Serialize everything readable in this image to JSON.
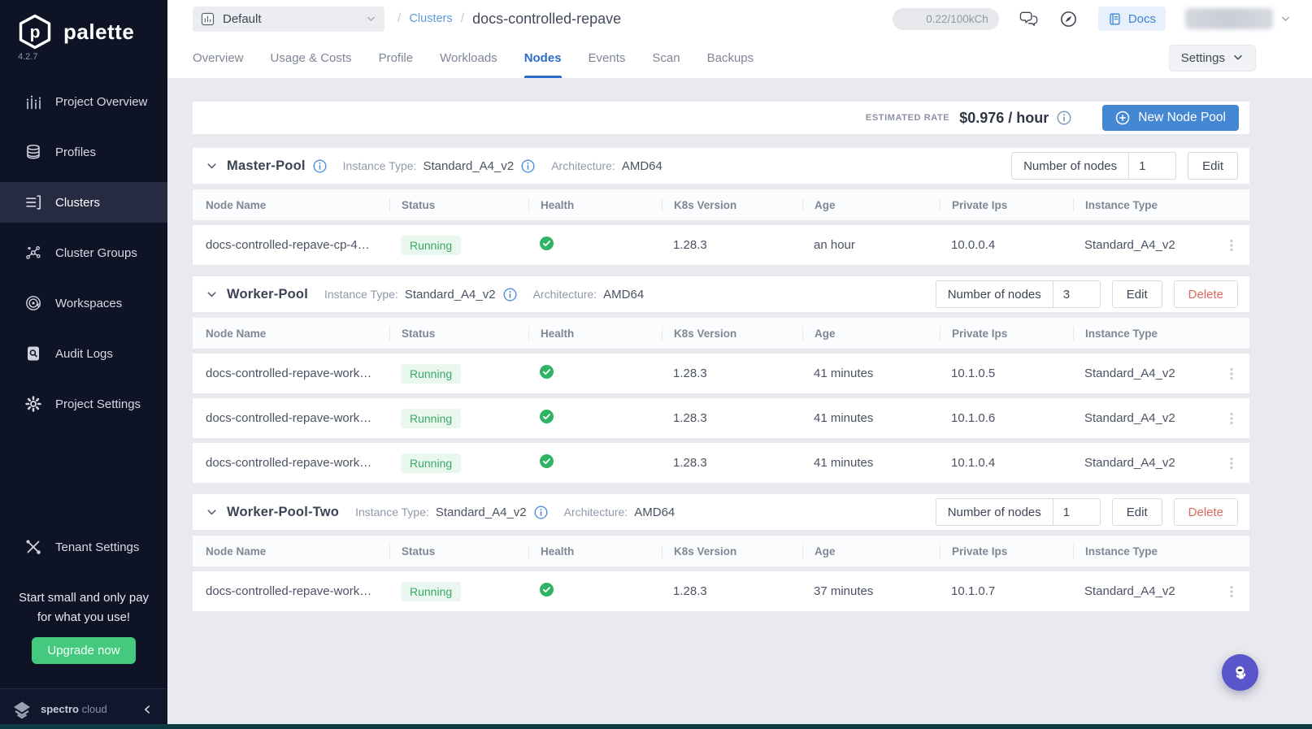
{
  "brand": {
    "name": "palette",
    "version": "4.2.7"
  },
  "sidebar": {
    "items": [
      {
        "label": "Project Overview",
        "icon": "chart",
        "active": false
      },
      {
        "label": "Profiles",
        "icon": "layers",
        "active": false
      },
      {
        "label": "Clusters",
        "icon": "clusters",
        "active": true
      },
      {
        "label": "Cluster Groups",
        "icon": "network",
        "active": false
      },
      {
        "label": "Workspaces",
        "icon": "target",
        "active": false
      },
      {
        "label": "Audit Logs",
        "icon": "audit",
        "active": false
      },
      {
        "label": "Project Settings",
        "icon": "gear",
        "active": false
      },
      {
        "label": "Tenant Settings",
        "icon": "tools",
        "active": false,
        "spacer_before": true
      }
    ],
    "promo": {
      "line1": "Start small and only pay",
      "line2": "for what you use!",
      "upgrade_label": "Upgrade now"
    },
    "footer": {
      "brand_bold": "spectro",
      "brand_light": "cloud"
    }
  },
  "header": {
    "project_selector": {
      "value": "Default"
    },
    "breadcrumb": {
      "separator": "/",
      "section": "Clusters",
      "current": "docs-controlled-repave"
    },
    "usage_counter": "0.22/100kCh",
    "docs_label": "Docs"
  },
  "tabs": {
    "items": [
      "Overview",
      "Usage & Costs",
      "Profile",
      "Workloads",
      "Nodes",
      "Events",
      "Scan",
      "Backups"
    ],
    "active": "Nodes",
    "settings_label": "Settings"
  },
  "toolbar": {
    "estimated_rate_label": "ESTIMATED RATE",
    "estimated_rate_value": "$0.976 / hour",
    "new_node_pool_label": "New Node Pool"
  },
  "labels": {
    "instance_type": "Instance Type:",
    "architecture": "Architecture:",
    "number_of_nodes": "Number of nodes",
    "edit": "Edit",
    "delete": "Delete"
  },
  "table": {
    "columns": [
      "Node Name",
      "Status",
      "Health",
      "K8s Version",
      "Age",
      "Private Ips",
      "Instance Type"
    ]
  },
  "pools": [
    {
      "name": "Master-Pool",
      "has_info": true,
      "instance_type": "Standard_A4_v2",
      "architecture": "AMD64",
      "nodes_count": "1",
      "deletable": false,
      "rows": [
        {
          "name": "docs-controlled-repave-cp-4…",
          "status": "Running",
          "health": "healthy",
          "k8s_version": "1.28.3",
          "age": "an hour",
          "private_ip": "10.0.0.4",
          "instance_type": "Standard_A4_v2"
        }
      ]
    },
    {
      "name": "Worker-Pool",
      "has_info": false,
      "instance_type": "Standard_A4_v2",
      "architecture": "AMD64",
      "nodes_count": "3",
      "deletable": true,
      "rows": [
        {
          "name": "docs-controlled-repave-work…",
          "status": "Running",
          "health": "healthy",
          "k8s_version": "1.28.3",
          "age": "41 minutes",
          "private_ip": "10.1.0.5",
          "instance_type": "Standard_A4_v2"
        },
        {
          "name": "docs-controlled-repave-work…",
          "status": "Running",
          "health": "healthy",
          "k8s_version": "1.28.3",
          "age": "41 minutes",
          "private_ip": "10.1.0.6",
          "instance_type": "Standard_A4_v2"
        },
        {
          "name": "docs-controlled-repave-work…",
          "status": "Running",
          "health": "healthy",
          "k8s_version": "1.28.3",
          "age": "41 minutes",
          "private_ip": "10.1.0.4",
          "instance_type": "Standard_A4_v2"
        }
      ]
    },
    {
      "name": "Worker-Pool-Two",
      "has_info": false,
      "instance_type": "Standard_A4_v2",
      "architecture": "AMD64",
      "nodes_count": "1",
      "deletable": true,
      "rows": [
        {
          "name": "docs-controlled-repave-work…",
          "status": "Running",
          "health": "healthy",
          "k8s_version": "1.28.3",
          "age": "37 minutes",
          "private_ip": "10.1.0.7",
          "instance_type": "Standard_A4_v2"
        }
      ]
    }
  ],
  "colors": {
    "accent_blue": "#4488d4",
    "active_tab_blue": "#2d6cc9",
    "running_green": "#3aa965",
    "health_green": "#2fb464",
    "delete_red": "#dd6a5d",
    "sidebar_bg": "#0e1326",
    "upgrade_green": "#45c97e",
    "fab_purple": "#5a55c8"
  }
}
